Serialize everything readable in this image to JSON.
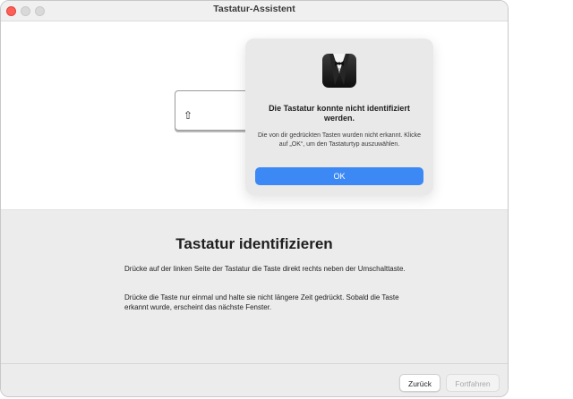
{
  "window": {
    "title": "Tastatur-Assistent"
  },
  "keycap": {
    "glyph": "⇧"
  },
  "dialog": {
    "icon": "keyboard-assistant-tuxedo-icon",
    "title": "Die Tastatur konnte nicht identifiziert werden.",
    "message": "Die von dir gedrückten Tasten wurden nicht erkannt. Klicke auf „OK“, um den Tastaturtyp auszuwählen.",
    "ok_label": "OK"
  },
  "content": {
    "heading": "Tastatur identifizieren",
    "paragraph1": "Drücke auf der linken Seite der Tastatur die Taste direkt rechts neben der Umschalttaste.",
    "paragraph2": "Drücke die Taste nur einmal und halte sie nicht längere Zeit gedrückt. Sobald die Taste erkannt wurde, erscheint das nächste Fenster."
  },
  "footer": {
    "back_label": "Zurück",
    "next_label": "Fortfahren"
  },
  "colors": {
    "accent": "#3c89f5",
    "close": "#fe5f57"
  }
}
